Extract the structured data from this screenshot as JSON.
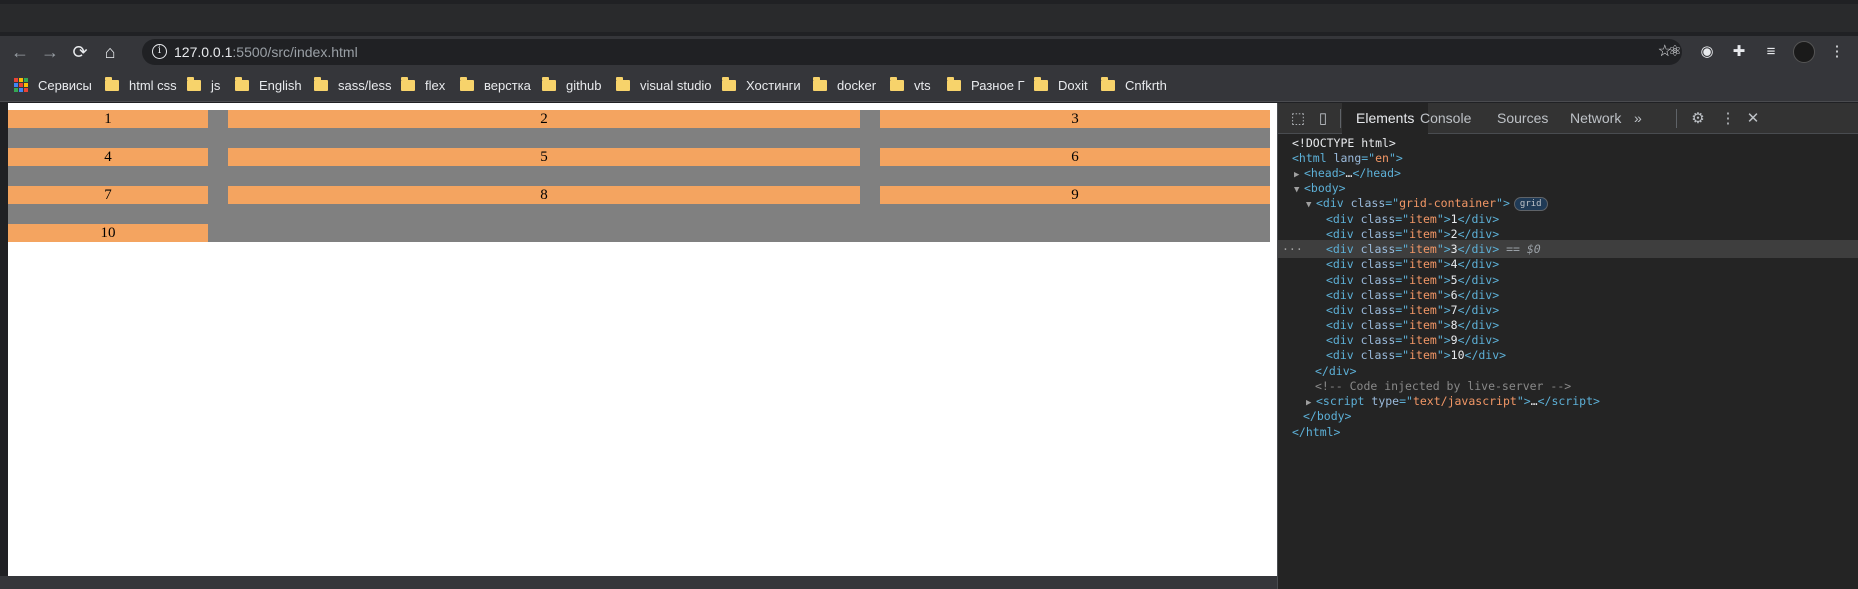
{
  "browser": {
    "url_host": "127.0.0.1",
    "url_rest": ":5500/src/index.html",
    "icons": {
      "back": "arrow-left-icon",
      "forward": "arrow-right-icon",
      "reload": "reload-icon",
      "home": "home-icon",
      "info": "info-icon",
      "star": "star-icon",
      "extensions": [
        "react-icon",
        "record-icon",
        "puzzle-icon",
        "playlist-icon"
      ],
      "menu": "kebab-menu-icon"
    }
  },
  "bookmarks": [
    {
      "label": "Сервисы",
      "type": "apps"
    },
    {
      "label": "html css",
      "type": "folder"
    },
    {
      "label": "js",
      "type": "folder"
    },
    {
      "label": "English",
      "type": "folder"
    },
    {
      "label": "sass/less",
      "type": "folder"
    },
    {
      "label": "flex",
      "type": "folder"
    },
    {
      "label": "верстка",
      "type": "folder"
    },
    {
      "label": "github",
      "type": "folder"
    },
    {
      "label": "visual studio",
      "type": "folder"
    },
    {
      "label": "Хостинги",
      "type": "folder"
    },
    {
      "label": "docker",
      "type": "folder"
    },
    {
      "label": "vts",
      "type": "folder"
    },
    {
      "label": "Разное Г",
      "type": "folder"
    },
    {
      "label": "Doxit",
      "type": "folder"
    },
    {
      "label": "Cnfkrth",
      "type": "folder"
    }
  ],
  "page": {
    "items": [
      "1",
      "2",
      "3",
      "4",
      "5",
      "6",
      "7",
      "8",
      "9",
      "10"
    ],
    "colors": {
      "item": "#f4a460",
      "container": "#808080"
    }
  },
  "devtools": {
    "tabs": [
      "Elements",
      "Console",
      "Sources",
      "Network"
    ],
    "active_tab": "Elements",
    "more": "»",
    "dom": {
      "doctype": "<!DOCTYPE html>",
      "html_lang": "en",
      "container_class": "grid-container",
      "item_class": "item",
      "badge": "grid",
      "selected_marker": "== $0",
      "comment": "<!-- Code injected by live-server -->",
      "script_type": "text/javascript",
      "ellipsis": "…"
    }
  }
}
